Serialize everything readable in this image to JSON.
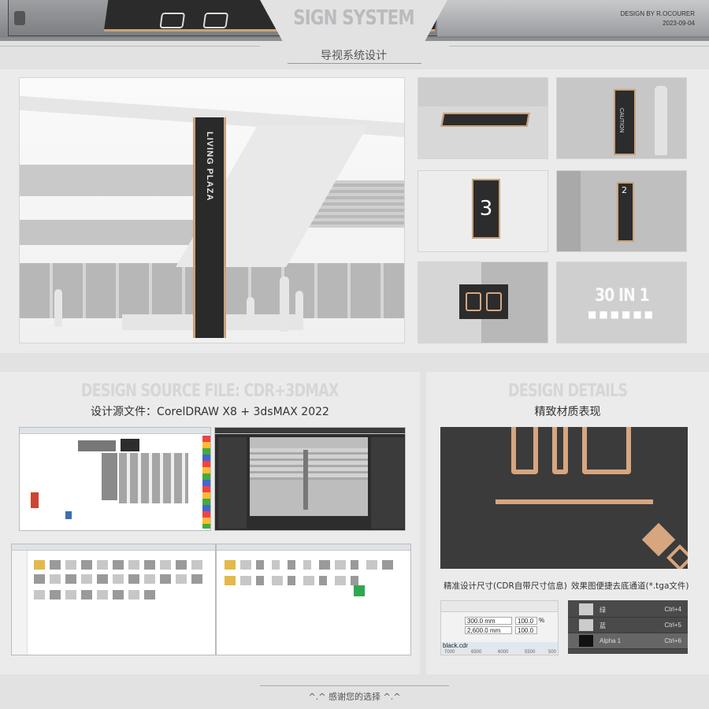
{
  "header": {
    "title": "SIGN SYSTEM",
    "subtitle": "导视系统设计",
    "design_by": "DESIGN BY R.OCOURER",
    "date": "2023-09-04"
  },
  "gallery": {
    "hero_sign_text": "LIVING PLAZA",
    "thumb_sign_number": "3",
    "thumb_floor_number": "2",
    "thumb_caution": "CAUTION",
    "bundle_label": "30 IN 1",
    "bundle_dots": "■■■■■■"
  },
  "source_panel": {
    "ghost_title": "DESIGN SOURCE FILE: CDR+3DMAX",
    "title": "设计源文件：CorelDRAW X8  +  3dsMAX 2022"
  },
  "details_panel": {
    "ghost_title": "DESIGN DETAILS",
    "title": "精致材质表现",
    "caption_dims": "精准设计尺寸(CDR自带尺寸信息)",
    "caption_alpha": "效果图便捷去底通道(*.tga文件)",
    "dims": {
      "width": "300.0 mm",
      "height": "2,600.0 mm",
      "scale_w": "100.0",
      "scale_h": "100.0",
      "pct": "%",
      "file": "black.cdr",
      "ruler": [
        "7000",
        "6500",
        "6000",
        "5500",
        "500"
      ]
    },
    "channels": [
      {
        "name": "绿",
        "shortcut": "Ctrl+4"
      },
      {
        "name": "蓝",
        "shortcut": "Ctrl+5"
      },
      {
        "name": "Alpha 1",
        "shortcut": "Ctrl+6"
      }
    ]
  },
  "footer": {
    "text": "^.^  感谢您的选择  ^.^"
  }
}
